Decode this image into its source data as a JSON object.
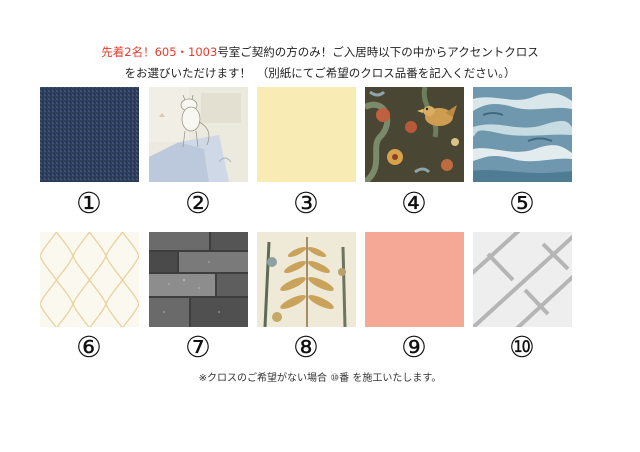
{
  "header": {
    "red_prefix": "先着2名！605・1003",
    "line1_rest": "号室ご契約の方のみ！ご入居時以下の中からアクセントクロス",
    "line2": "をお選びいただけます！　（別紙にてご希望のクロス品番を記入ください。）"
  },
  "swatches": [
    {
      "number": "①",
      "description": "navy-woven-fabric",
      "color": "#2e3f5c"
    },
    {
      "number": "②",
      "description": "moomin-illustration",
      "color": "#e9e6dc"
    },
    {
      "number": "③",
      "description": "plain-cream",
      "color": "#f7eab2"
    },
    {
      "number": "④",
      "description": "bird-floral-pattern",
      "color": "#4f4a36"
    },
    {
      "number": "⑤",
      "description": "blue-watercolor",
      "color": "#5f8ca3"
    },
    {
      "number": "⑥",
      "description": "ivory-lattice",
      "color": "#faf7ef"
    },
    {
      "number": "⑦",
      "description": "grey-stone-bricks",
      "color": "#4d4d4d"
    },
    {
      "number": "⑧",
      "description": "fern-botanical",
      "color": "#c9a35c"
    },
    {
      "number": "⑨",
      "description": "plain-salmon-pink",
      "color": "#f5a898"
    },
    {
      "number": "⑩",
      "description": "white-herringbone-tile",
      "color": "#eeeeee"
    }
  ],
  "footnote": "※クロスのご希望がない場合 ⑩番 を施工いたします。"
}
